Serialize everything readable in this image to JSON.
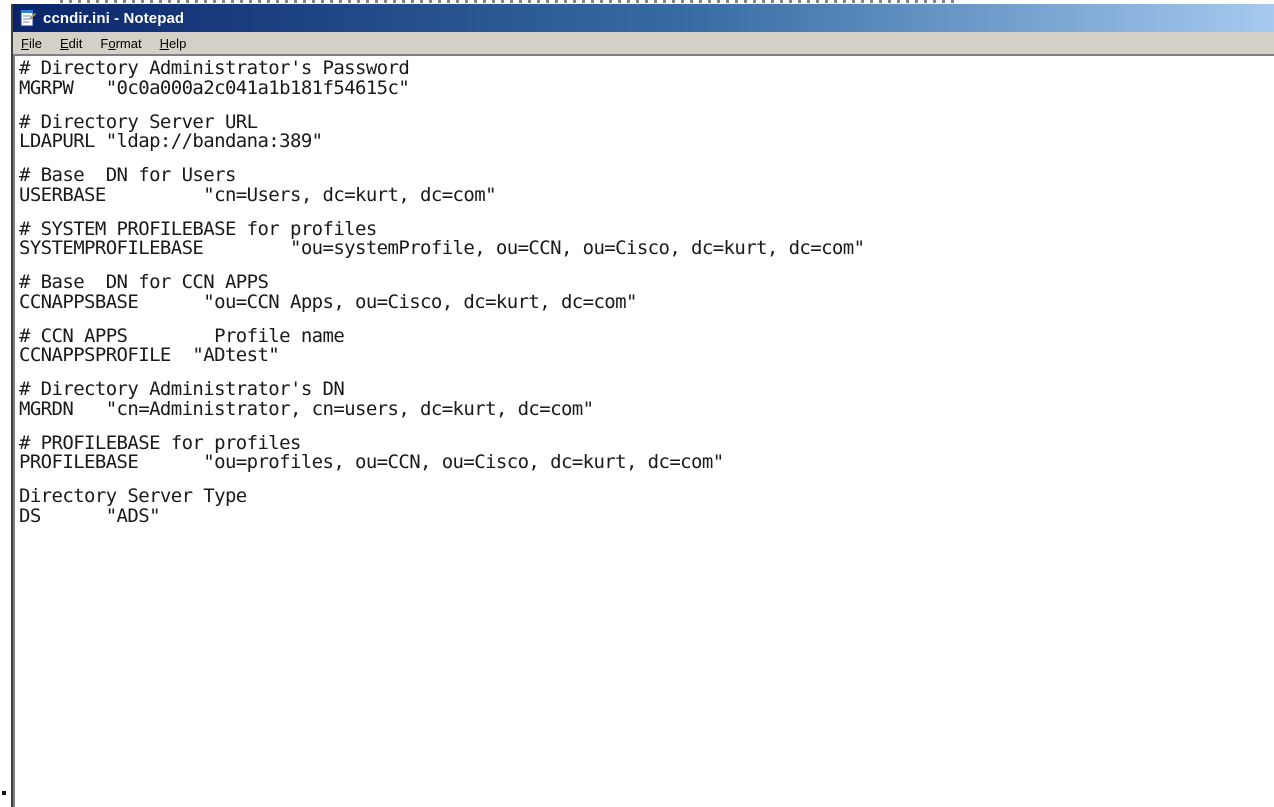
{
  "window": {
    "title": "ccndir.ini - Notepad",
    "icon": "notepad-icon",
    "titlebar_colors": [
      "#0a246a",
      "#3a6ea5",
      "#a6caf0"
    ]
  },
  "menu": {
    "items": [
      {
        "label": "File",
        "accel": "F"
      },
      {
        "label": "Edit",
        "accel": "E"
      },
      {
        "label": "Format",
        "accel": "o"
      },
      {
        "label": "Help",
        "accel": "H"
      }
    ]
  },
  "document": {
    "blocks": [
      [
        "# Directory Administrator's Password",
        "MGRPW   \"0c0a000a2c041a1b181f54615c\""
      ],
      [
        "# Directory Server URL",
        "LDAPURL \"ldap://bandana:389\""
      ],
      [
        "# Base  DN for Users",
        "USERBASE         \"cn=Users, dc=kurt, dc=com\""
      ],
      [
        "# SYSTEM PROFILEBASE for profiles",
        "SYSTEMPROFILEBASE        \"ou=systemProfile, ou=CCN, ou=Cisco, dc=kurt, dc=com\""
      ],
      [
        "# Base  DN for CCN APPS",
        "CCNAPPSBASE      \"ou=CCN Apps, ou=Cisco, dc=kurt, dc=com\""
      ],
      [
        "# CCN APPS        Profile name",
        "CCNAPPSPROFILE  \"ADtest\""
      ],
      [
        "# Directory Administrator's DN",
        "MGRDN   \"cn=Administrator, cn=users, dc=kurt, dc=com\""
      ],
      [
        "# PROFILEBASE for profiles",
        "PROFILEBASE      \"ou=profiles, ou=CCN, ou=Cisco, dc=kurt, dc=com\""
      ],
      [
        "Directory Server Type",
        "DS      \"ADS\""
      ]
    ]
  }
}
